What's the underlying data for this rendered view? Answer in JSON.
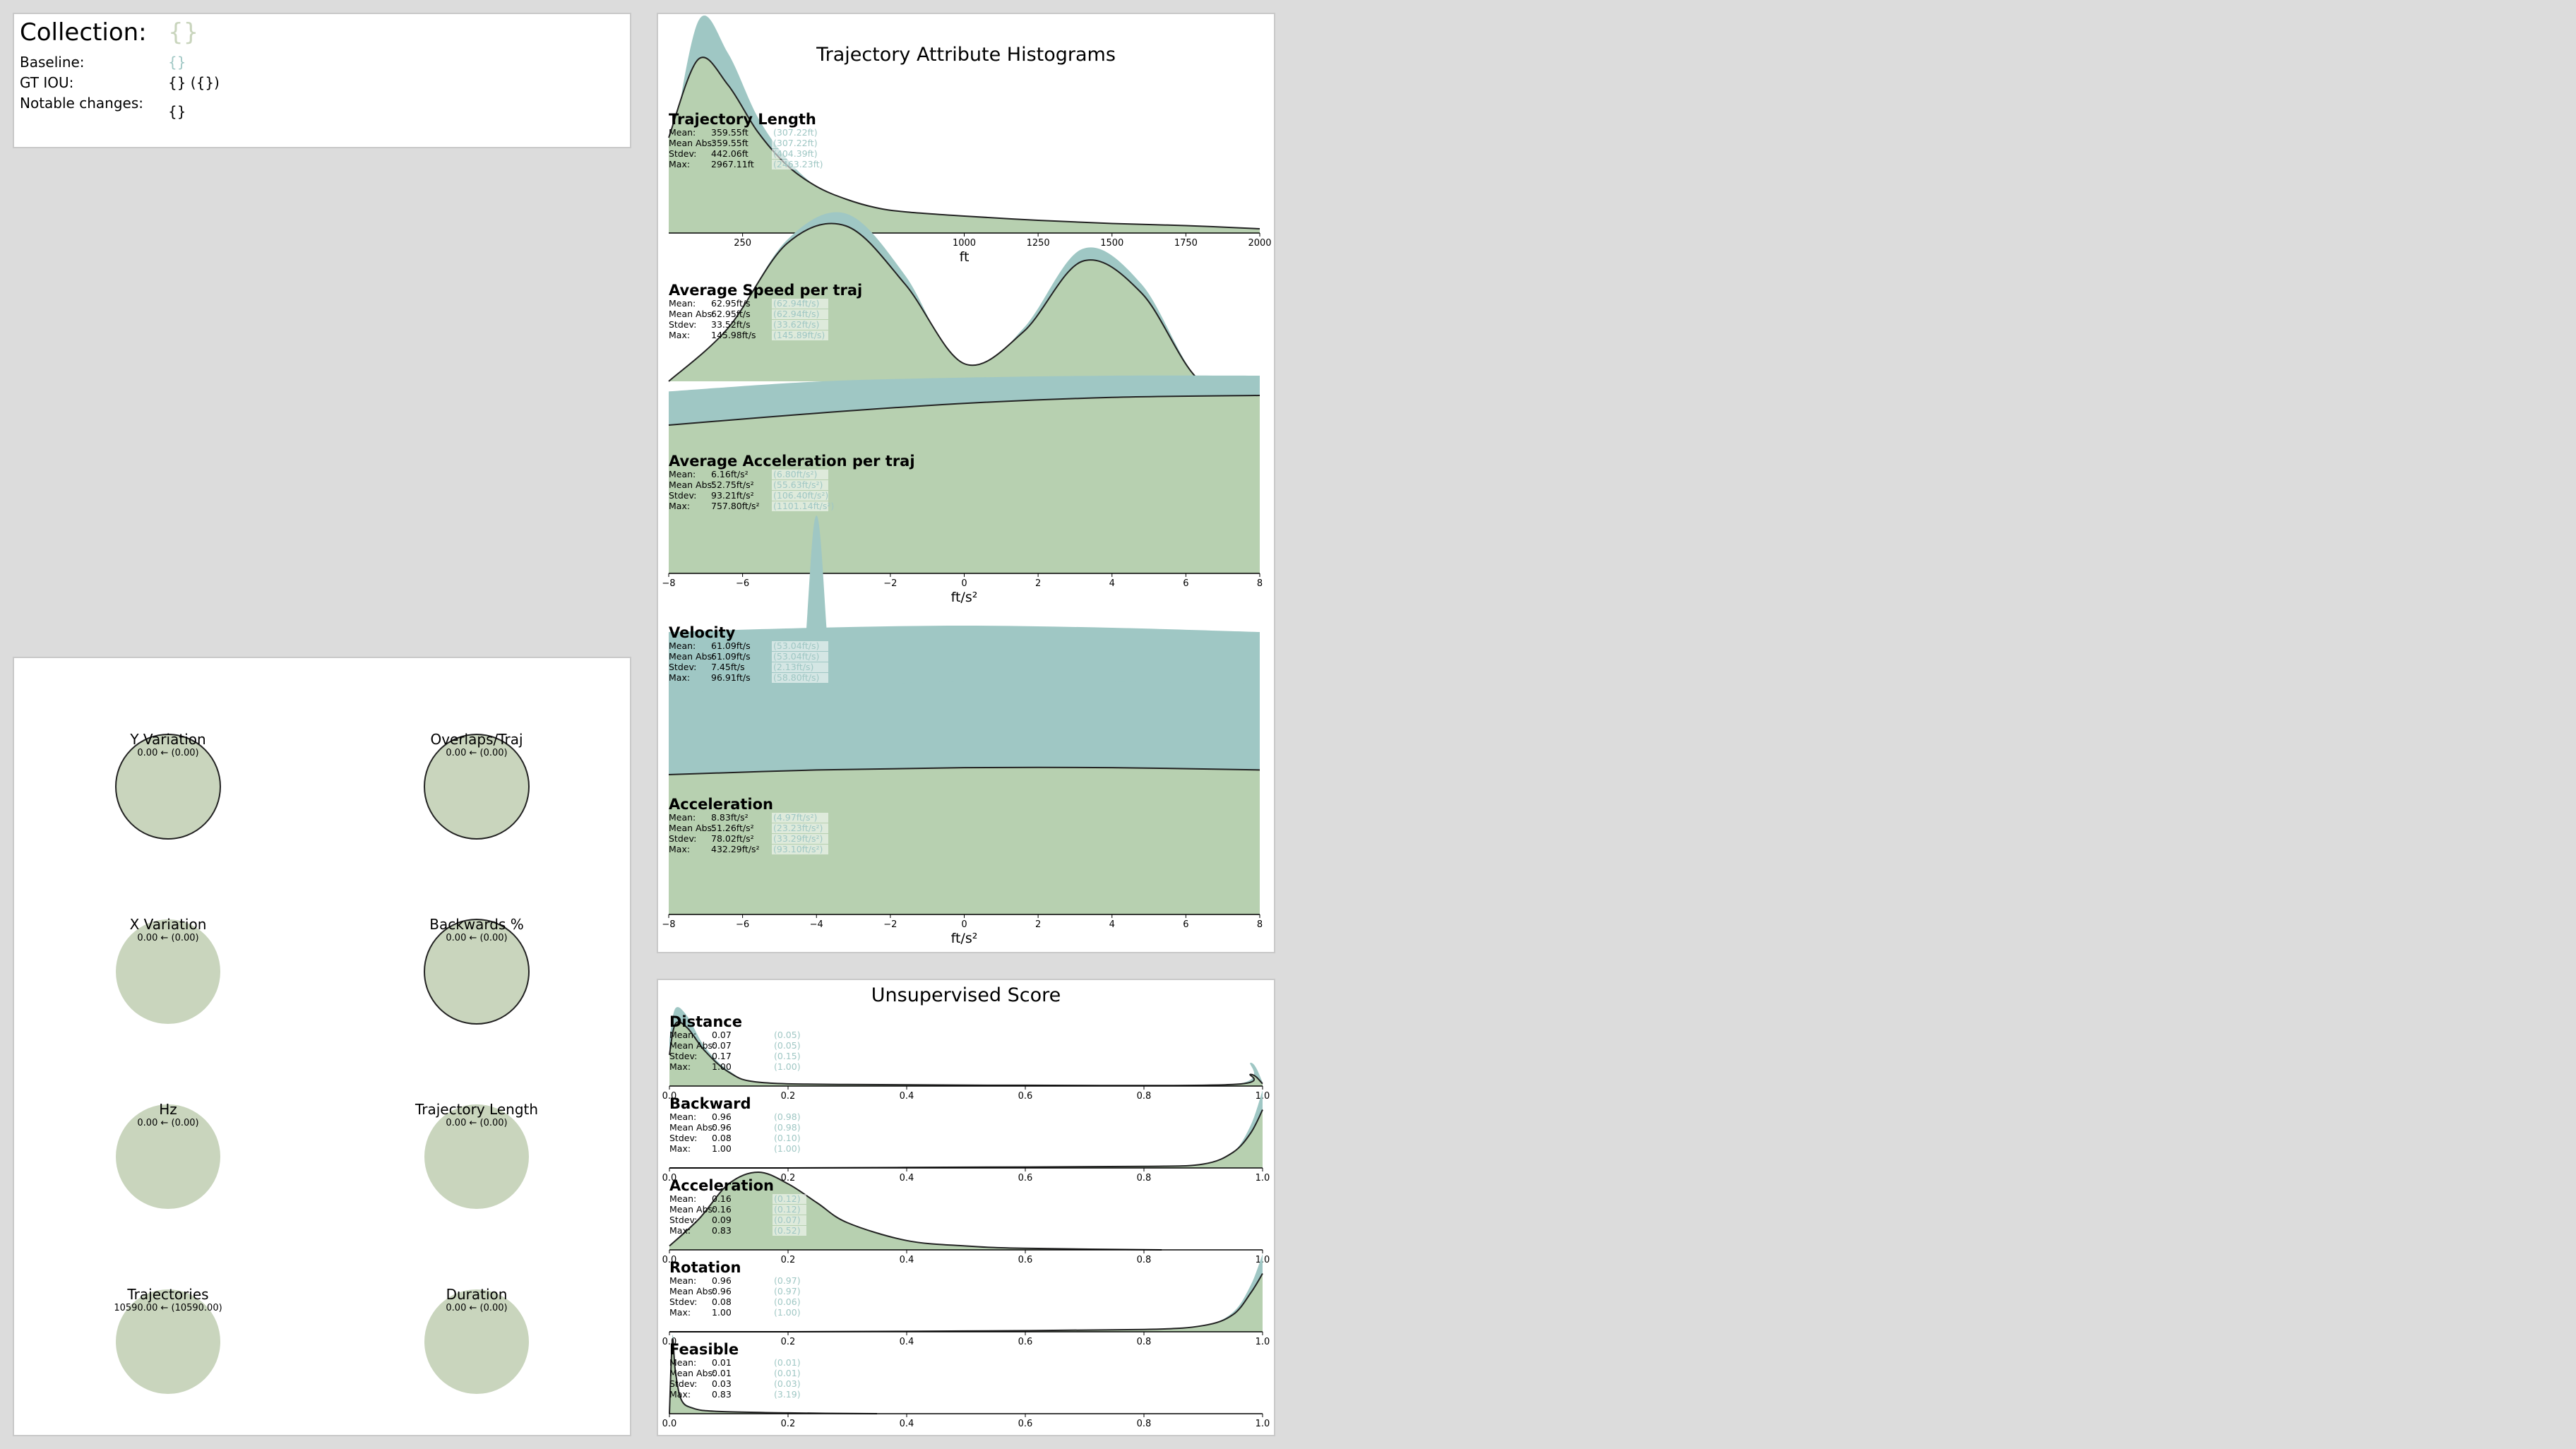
{
  "colors": {
    "baseline": "#9fc7c4",
    "current": "#b7d0b0",
    "current_light": "#c9d5bd",
    "overlap": "#dde3cf",
    "line": "#222222"
  },
  "info": {
    "collection_label": "Collection:",
    "collection_value": "{}",
    "baseline_label": "Baseline:",
    "baseline_value": "{}",
    "gt_iou_label": "GT IOU:",
    "gt_iou_value": "{} ({})",
    "notable_label": "Notable changes:",
    "notable_value": "{}"
  },
  "circles": [
    {
      "label": "Y Variation",
      "value": "0.00  ← (0.00)",
      "outlined": true
    },
    {
      "label": "Overlaps/Traj",
      "value": "0.00  ← (0.00)",
      "outlined": true
    },
    {
      "label": "X Variation",
      "value": "0.00  ← (0.00)",
      "outlined": false
    },
    {
      "label": "Backwards %",
      "value": "0.00  ← (0.00)",
      "outlined": true
    },
    {
      "label": "Hz",
      "value": "0.00  ← (0.00)",
      "outlined": false
    },
    {
      "label": "Trajectory Length",
      "value": "0.00  ← (0.00)",
      "outlined": false
    },
    {
      "label": "Trajectories",
      "value": "10590.00  ← (10590.00)",
      "outlined": false
    },
    {
      "label": "Duration",
      "value": "0.00  ← (0.00)",
      "outlined": false
    }
  ],
  "histograms": {
    "title": "Trajectory Attribute Histograms",
    "panels": [
      {
        "name": "Trajectory Length",
        "stats": [
          [
            "Mean:",
            "359.55ft",
            "(307.22ft)"
          ],
          [
            "Mean Abs:",
            "359.55ft",
            "(307.22ft)"
          ],
          [
            "Stdev:",
            "442.06ft",
            "(404.39ft)"
          ],
          [
            "Max:",
            "2967.11ft",
            "(2463.23ft)"
          ]
        ],
        "x_ticks": [
          "250",
          "",
          "",
          "1000",
          "1250",
          "1500",
          "1750",
          "2000"
        ],
        "x_label": "ft"
      },
      {
        "name": "Average Speed per traj",
        "stats": [
          [
            "Mean:",
            "62.95ft/s",
            "(62.94ft/s)"
          ],
          [
            "Mean Abs:",
            "62.95ft/s",
            "(62.94ft/s)"
          ],
          [
            "Stdev:",
            "33.52ft/s",
            "(33.62ft/s)"
          ],
          [
            "Max:",
            "145.98ft/s",
            "(145.89ft/s)"
          ]
        ],
        "x_ticks": [],
        "x_label": ""
      },
      {
        "name": "Average Acceleration per traj",
        "stats": [
          [
            "Mean:",
            "6.16ft/s²",
            "(6.80ft/s²)"
          ],
          [
            "Mean Abs:",
            "52.75ft/s²",
            "(55.63ft/s²)"
          ],
          [
            "Stdev:",
            "93.21ft/s²",
            "(106.40ft/s²)"
          ],
          [
            "Max:",
            "757.80ft/s²",
            "(1101.14ft/s²)"
          ]
        ],
        "x_ticks": [
          "−8",
          "−6",
          "−4",
          "−2",
          "0",
          "2",
          "4",
          "6",
          "8"
        ],
        "x_label": "ft/s²"
      },
      {
        "name": "Velocity",
        "stats": [
          [
            "Mean:",
            "61.09ft/s",
            "(53.04ft/s)"
          ],
          [
            "Mean Abs:",
            "61.09ft/s",
            "(53.04ft/s)"
          ],
          [
            "Stdev:",
            "7.45ft/s",
            "(2.13ft/s)"
          ],
          [
            "Max:",
            "96.91ft/s",
            "(58.80ft/s)"
          ]
        ],
        "x_ticks": [],
        "x_label": ""
      },
      {
        "name": "Acceleration",
        "stats": [
          [
            "Mean:",
            "8.83ft/s²",
            "(4.97ft/s²)"
          ],
          [
            "Mean Abs:",
            "51.26ft/s²",
            "(23.23ft/s²)"
          ],
          [
            "Stdev:",
            "78.02ft/s²",
            "(33.29ft/s²)"
          ],
          [
            "Max:",
            "432.29ft/s²",
            "(93.10ft/s²)"
          ]
        ],
        "x_ticks": [
          "−8",
          "−6",
          "−4",
          "−2",
          "0",
          "2",
          "4",
          "6",
          "8"
        ],
        "x_label": "ft/s²"
      }
    ]
  },
  "unsupervised": {
    "title": "Unsupervised Score",
    "x_ticks": [
      "0.0",
      "0.2",
      "0.4",
      "0.6",
      "0.8",
      "1.0"
    ],
    "panels": [
      {
        "name": "Distance",
        "stats": [
          [
            "Mean:",
            "0.07",
            "(0.05)"
          ],
          [
            "Mean Abs:",
            "0.07",
            "(0.05)"
          ],
          [
            "Stdev:",
            "0.17",
            "(0.15)"
          ],
          [
            "Max:",
            "1.00",
            "(1.00)"
          ]
        ]
      },
      {
        "name": "Backward",
        "stats": [
          [
            "Mean:",
            "0.96",
            "(0.98)"
          ],
          [
            "Mean Abs:",
            "0.96",
            "(0.98)"
          ],
          [
            "Stdev:",
            "0.08",
            "(0.10)"
          ],
          [
            "Max:",
            "1.00",
            "(1.00)"
          ]
        ]
      },
      {
        "name": "Acceleration",
        "stats": [
          [
            "Mean:",
            "0.16",
            "(0.12)"
          ],
          [
            "Mean Abs:",
            "0.16",
            "(0.12)"
          ],
          [
            "Stdev:",
            "0.09",
            "(0.07)"
          ],
          [
            "Max:",
            "0.83",
            "(0.52)"
          ]
        ]
      },
      {
        "name": "Rotation",
        "stats": [
          [
            "Mean:",
            "0.96",
            "(0.97)"
          ],
          [
            "Mean Abs:",
            "0.96",
            "(0.97)"
          ],
          [
            "Stdev:",
            "0.08",
            "(0.06)"
          ],
          [
            "Max:",
            "1.00",
            "(1.00)"
          ]
        ]
      },
      {
        "name": "Feasible",
        "stats": [
          [
            "Mean:",
            "0.01",
            "(0.01)"
          ],
          [
            "Mean Abs:",
            "0.01",
            "(0.01)"
          ],
          [
            "Stdev:",
            "0.03",
            "(0.03)"
          ],
          [
            "Max:",
            "0.83",
            "(3.19)"
          ]
        ]
      }
    ]
  },
  "chart_data": [
    {
      "type": "area",
      "title": "Trajectory Length",
      "xlabel": "ft",
      "xlim": [
        0,
        2000
      ],
      "series": [
        {
          "x": [
            0,
            100,
            200,
            300,
            400,
            500,
            600,
            700,
            800,
            1000,
            1250,
            1500,
            1750,
            2000
          ],
          "values": [
            0.3,
            1.0,
            0.85,
            0.55,
            0.35,
            0.22,
            0.16,
            0.12,
            0.1,
            0.08,
            0.06,
            0.045,
            0.035,
            0.02
          ]
        },
        {
          "x": [
            0,
            100,
            200,
            300,
            400,
            500,
            600,
            700,
            800,
            1000,
            1250,
            1500,
            1750,
            2000
          ],
          "values": [
            0.45,
            0.82,
            0.7,
            0.48,
            0.32,
            0.22,
            0.16,
            0.12,
            0.1,
            0.08,
            0.06,
            0.045,
            0.035,
            0.02
          ]
        }
      ]
    },
    {
      "type": "area",
      "title": "Average Speed per traj",
      "series": [
        {
          "x": [
            0,
            30,
            60,
            90,
            120,
            150,
            180,
            210,
            240,
            270,
            300
          ],
          "values": [
            0.0,
            0.3,
            0.8,
            0.95,
            0.6,
            0.05,
            0.3,
            0.75,
            0.55,
            0.0,
            0.0
          ]
        },
        {
          "x": [
            0,
            30,
            60,
            90,
            120,
            150,
            180,
            210,
            240,
            270,
            300
          ],
          "values": [
            0.0,
            0.3,
            0.78,
            0.88,
            0.55,
            0.1,
            0.28,
            0.68,
            0.5,
            0.0,
            0.0
          ]
        }
      ]
    },
    {
      "type": "area",
      "title": "Average Acceleration per traj",
      "xlabel": "ft/s²",
      "xlim": [
        -8,
        8
      ],
      "series": [
        {
          "x": [
            -8,
            -4,
            0,
            4,
            8
          ],
          "values": [
            0.92,
            0.97,
            0.99,
            1.0,
            1.0
          ]
        },
        {
          "x": [
            -8,
            -4,
            0,
            4,
            8
          ],
          "values": [
            0.75,
            0.81,
            0.86,
            0.89,
            0.9
          ]
        }
      ]
    },
    {
      "type": "area",
      "title": "Velocity",
      "series": [
        {
          "x": [
            -8,
            -5.5,
            -4.5,
            -4.0,
            -3.5,
            -2.5,
            8
          ],
          "values": [
            0.0,
            0.0,
            0.1,
            1.0,
            0.1,
            0.0,
            0.0
          ]
        },
        {
          "x": [
            -8,
            -4,
            -3,
            -2,
            -1,
            0,
            8
          ],
          "values": [
            0.0,
            0.0,
            0.15,
            0.3,
            0.15,
            0.0,
            0.0
          ]
        },
        {
          "x": [
            -8,
            -4,
            0,
            4,
            8
          ],
          "values": [
            0.45,
            0.47,
            0.48,
            0.47,
            0.45
          ]
        }
      ]
    },
    {
      "type": "area",
      "title": "Acceleration",
      "xlabel": "ft/s²",
      "xlim": [
        -8,
        8
      ],
      "series": [
        {
          "x": [
            -8,
            -4,
            0,
            4,
            8
          ],
          "values": [
            0.95,
            0.98,
            1.0,
            1.0,
            0.99
          ]
        },
        {
          "x": [
            -8,
            -4,
            0,
            4,
            8
          ],
          "values": [
            0.6,
            0.62,
            0.63,
            0.63,
            0.62
          ]
        }
      ]
    },
    {
      "type": "area",
      "title": "Distance",
      "xlim": [
        0,
        1
      ],
      "series": [
        {
          "x": [
            0,
            0.01,
            0.03,
            0.06,
            0.1,
            0.15,
            0.3,
            0.6,
            0.95,
            0.98,
            1.0
          ],
          "values": [
            0.6,
            1.0,
            0.9,
            0.5,
            0.2,
            0.05,
            0.02,
            0.01,
            0.02,
            0.3,
            0.05
          ]
        },
        {
          "x": [
            0,
            0.01,
            0.03,
            0.06,
            0.1,
            0.15,
            0.3,
            0.6,
            0.95,
            0.98,
            1.0
          ],
          "values": [
            0.4,
            0.8,
            0.75,
            0.45,
            0.18,
            0.05,
            0.02,
            0.01,
            0.02,
            0.15,
            0.03
          ]
        }
      ]
    },
    {
      "type": "area",
      "title": "Backward",
      "xlim": [
        0,
        1
      ],
      "series": [
        {
          "x": [
            0,
            0.2,
            0.5,
            0.8,
            0.9,
            0.95,
            0.98,
            1.0
          ],
          "values": [
            0.0,
            0.0,
            0.01,
            0.02,
            0.05,
            0.2,
            0.55,
            1.0
          ]
        },
        {
          "x": [
            0,
            0.2,
            0.5,
            0.8,
            0.9,
            0.95,
            0.98,
            1.0
          ],
          "values": [
            0.0,
            0.0,
            0.01,
            0.02,
            0.05,
            0.2,
            0.45,
            0.75
          ]
        }
      ]
    },
    {
      "type": "area",
      "title": "Acceleration",
      "xlim": [
        0,
        1
      ],
      "series": [
        {
          "x": [
            0,
            0.05,
            0.1,
            0.15,
            0.2,
            0.25,
            0.3,
            0.4,
            0.5,
            0.6,
            0.83
          ],
          "values": [
            0.05,
            0.4,
            0.85,
            1.0,
            0.85,
            0.6,
            0.35,
            0.12,
            0.05,
            0.02,
            0.0
          ]
        },
        {
          "x": [
            0,
            0.05,
            0.1,
            0.15,
            0.2,
            0.25,
            0.3,
            0.4,
            0.5,
            0.6,
            0.83
          ],
          "values": [
            0.05,
            0.4,
            0.85,
            1.0,
            0.85,
            0.6,
            0.35,
            0.12,
            0.05,
            0.02,
            0.0
          ]
        }
      ]
    },
    {
      "type": "area",
      "title": "Rotation",
      "xlim": [
        0,
        1
      ],
      "series": [
        {
          "x": [
            0,
            0.2,
            0.5,
            0.8,
            0.9,
            0.95,
            0.98,
            1.0
          ],
          "values": [
            0.0,
            0.0,
            0.01,
            0.03,
            0.08,
            0.25,
            0.6,
            1.0
          ]
        },
        {
          "x": [
            0,
            0.2,
            0.5,
            0.8,
            0.9,
            0.95,
            0.98,
            1.0
          ],
          "values": [
            0.0,
            0.0,
            0.01,
            0.03,
            0.08,
            0.22,
            0.5,
            0.75
          ]
        }
      ]
    },
    {
      "type": "area",
      "title": "Feasible",
      "xlim": [
        0,
        1
      ],
      "series": [
        {
          "x": [
            0,
            0.005,
            0.01,
            0.02,
            0.04,
            0.08,
            0.2,
            0.35
          ],
          "values": [
            0.0,
            1.0,
            0.6,
            0.2,
            0.08,
            0.03,
            0.01,
            0.0
          ]
        },
        {
          "x": [
            0,
            0.005,
            0.01,
            0.02,
            0.04,
            0.08,
            0.2,
            0.35
          ],
          "values": [
            0.0,
            0.95,
            0.55,
            0.18,
            0.07,
            0.03,
            0.01,
            0.0
          ]
        }
      ]
    }
  ]
}
